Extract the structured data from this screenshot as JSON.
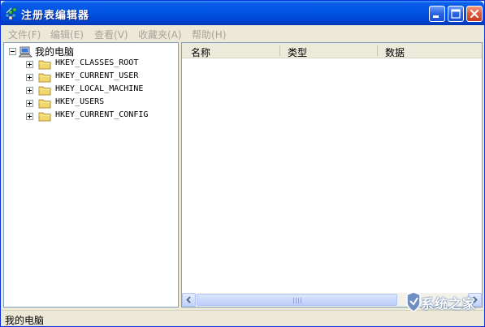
{
  "window": {
    "title": "注册表编辑器"
  },
  "menu": [
    {
      "label": "文件",
      "hotkey": "(F)"
    },
    {
      "label": "编辑",
      "hotkey": "(E)"
    },
    {
      "label": "查看",
      "hotkey": "(V)"
    },
    {
      "label": "收藏夹",
      "hotkey": "(A)"
    },
    {
      "label": "帮助",
      "hotkey": "(H)"
    }
  ],
  "tree": {
    "root": {
      "label": "我的电脑",
      "icon": "computer-icon"
    },
    "keys": [
      {
        "label": "HKEY_CLASSES_ROOT",
        "icon": "folder-icon"
      },
      {
        "label": "HKEY_CURRENT_USER",
        "icon": "folder-icon"
      },
      {
        "label": "HKEY_LOCAL_MACHINE",
        "icon": "folder-icon"
      },
      {
        "label": "HKEY_USERS",
        "icon": "folder-icon"
      },
      {
        "label": "HKEY_CURRENT_CONFIG",
        "icon": "folder-icon"
      }
    ]
  },
  "list": {
    "columns": [
      "名称",
      "类型",
      "数据"
    ]
  },
  "status": {
    "text": "我的电脑"
  },
  "watermark": {
    "text": "系统之家"
  },
  "colors": {
    "titlebar": "#0054e3",
    "close_button": "#e0583a",
    "window_face": "#ece9d8",
    "folder": "#f5d66b",
    "disabled_menu_text": "#a7a49a"
  }
}
